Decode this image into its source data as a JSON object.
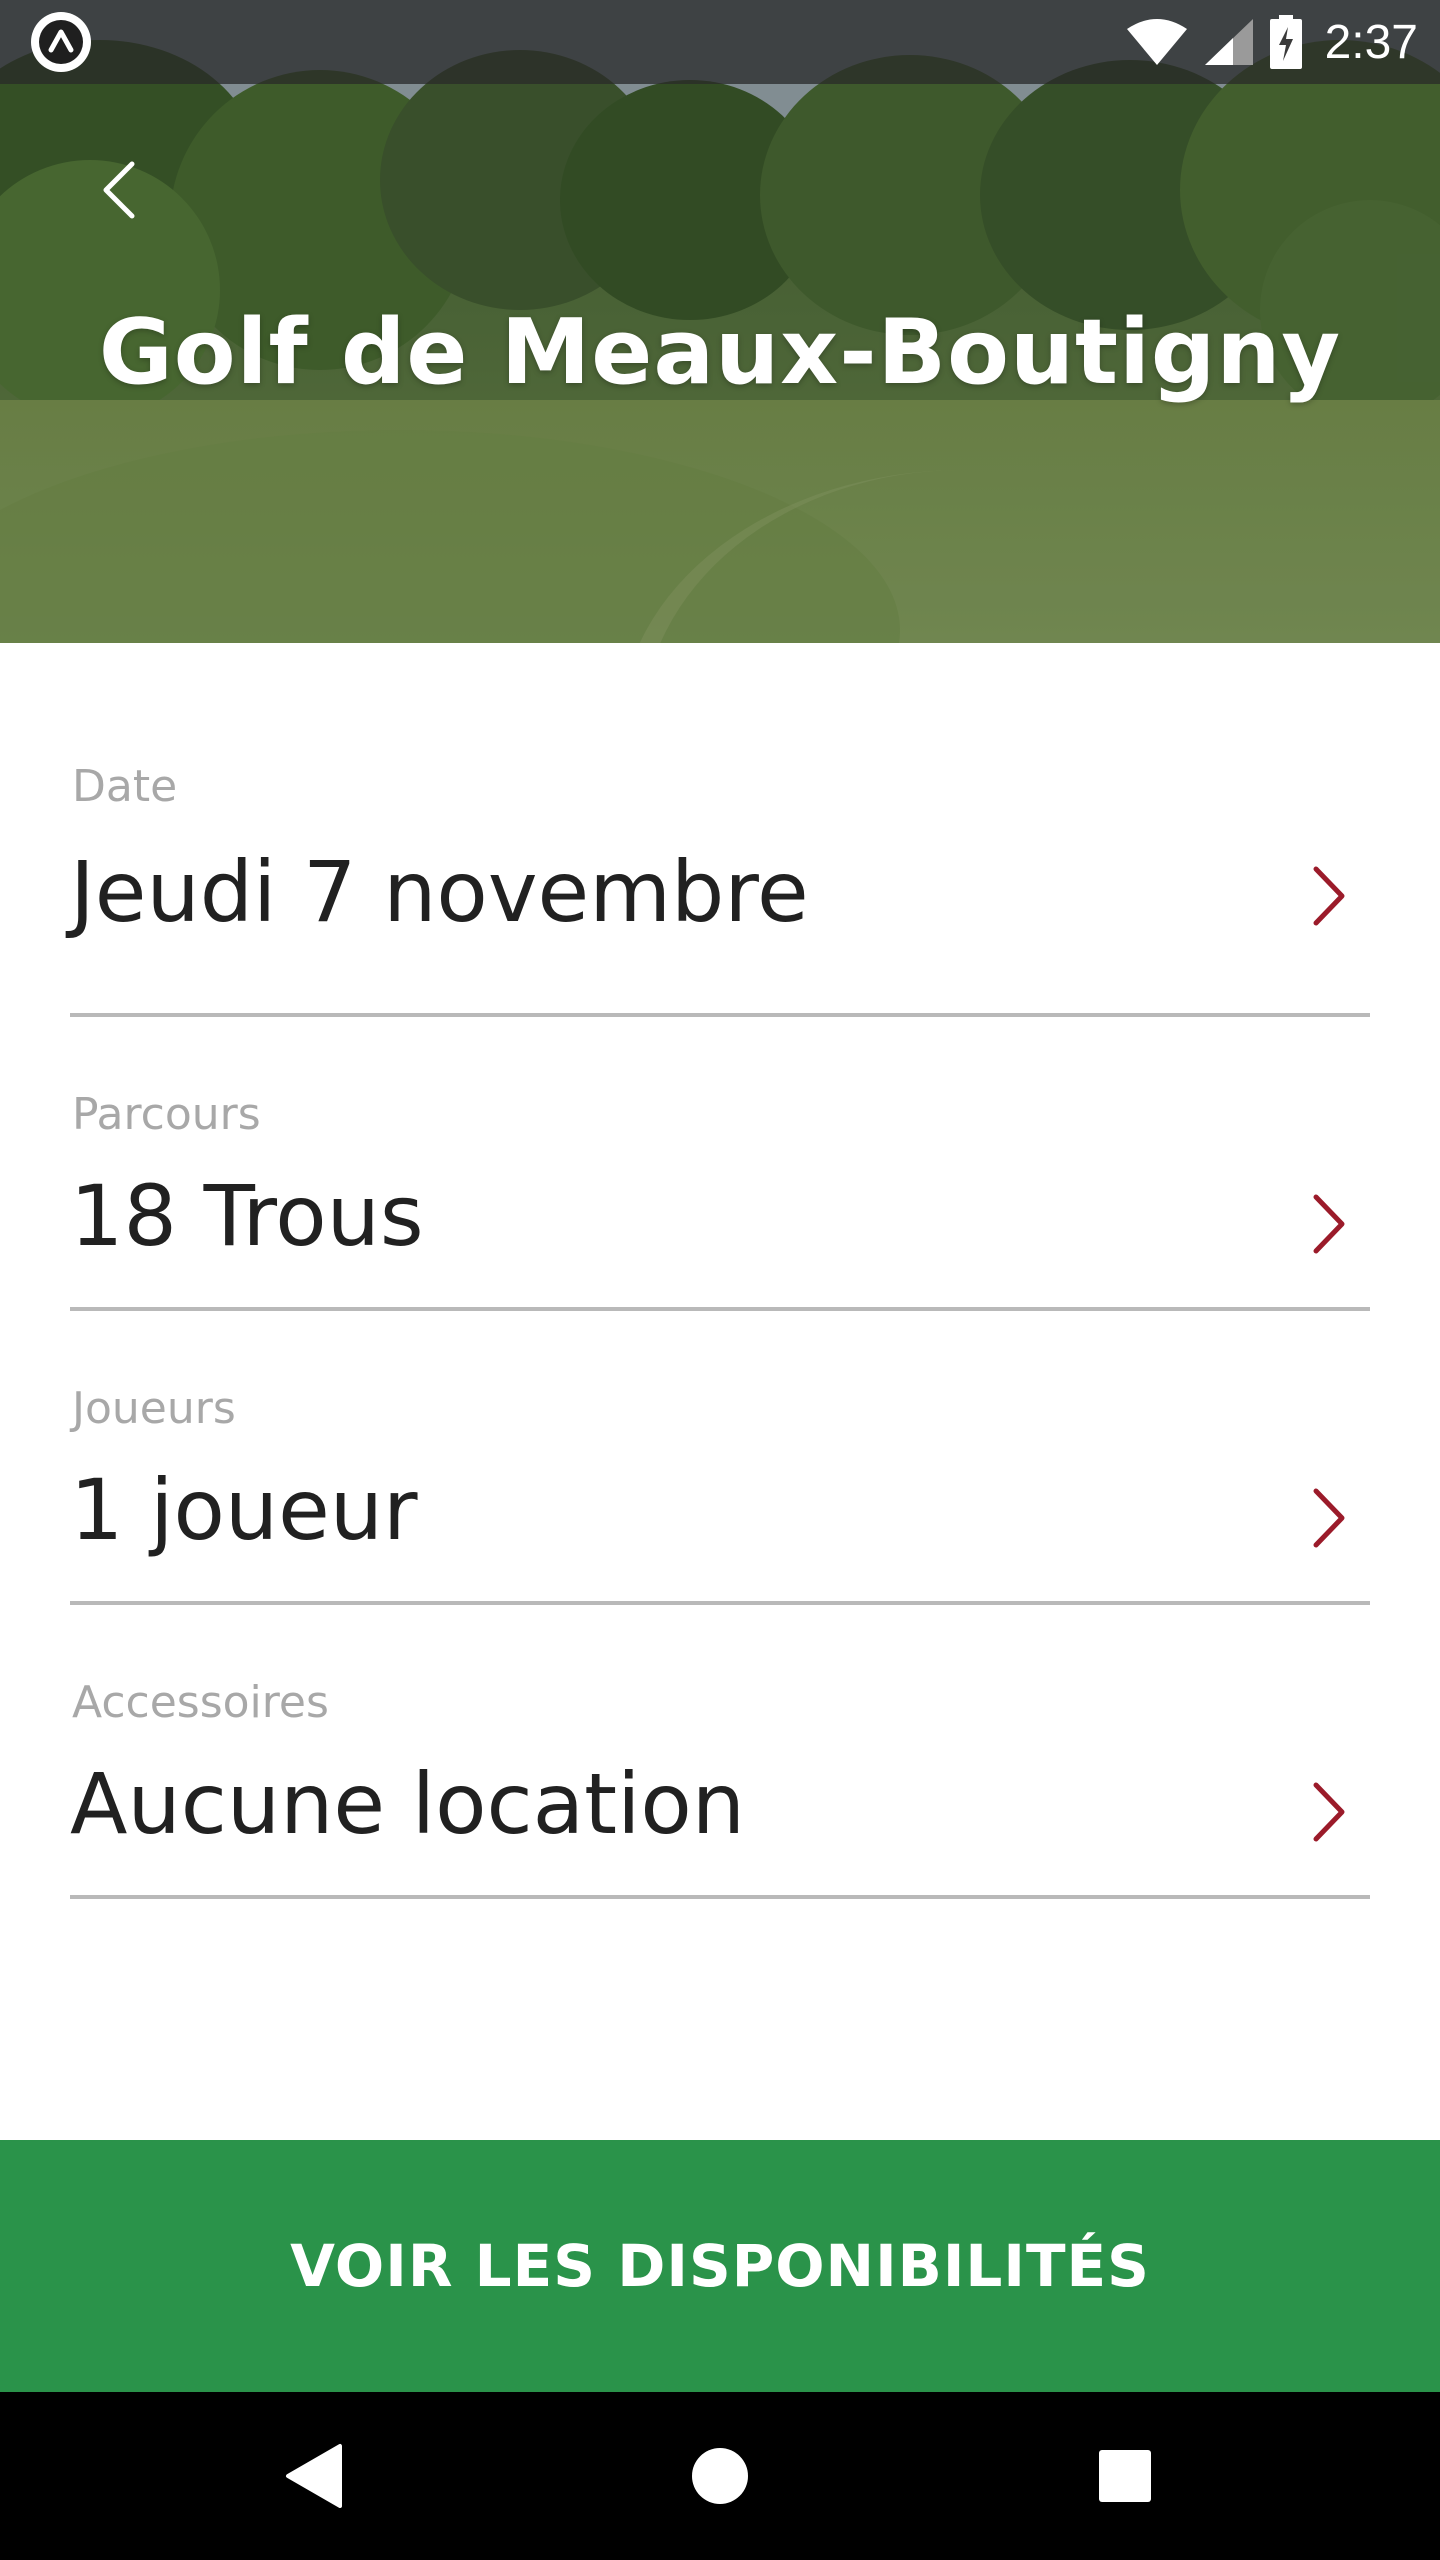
{
  "status_bar": {
    "time": "2:37",
    "icons": [
      "app-notification-icon",
      "wifi-icon",
      "cell-signal-icon",
      "battery-charging-icon"
    ]
  },
  "header": {
    "title": "Golf de Meaux-Boutigny",
    "back_icon": "chevron-left-icon"
  },
  "form": {
    "rows": [
      {
        "label": "Date",
        "value": "Jeudi 7 novembre"
      },
      {
        "label": "Parcours",
        "value": "18 Trous"
      },
      {
        "label": "Joueurs",
        "value": "1 joueur"
      },
      {
        "label": "Accessoires",
        "value": "Aucune location"
      }
    ],
    "chevron_icon": "chevron-right-icon"
  },
  "cta": {
    "label": "VOIR LES DISPONIBILITÉS"
  },
  "nav_bar": {
    "icons": [
      "nav-back-icon",
      "nav-home-icon",
      "nav-recents-icon"
    ]
  },
  "colors": {
    "accent_green": "#2a934a",
    "chevron_red": "#9b1b2a",
    "label_gray": "#a8a8a8",
    "value_text": "#212121",
    "divider": "#b9b9b9"
  }
}
